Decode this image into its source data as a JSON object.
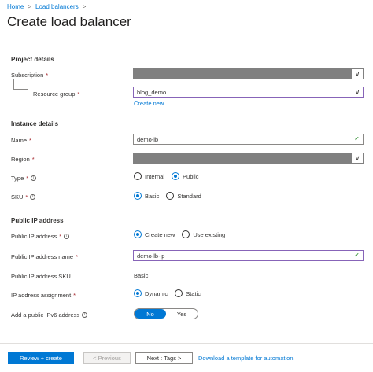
{
  "breadcrumb": {
    "items": [
      "Home",
      "Load balancers"
    ],
    "separator": ">"
  },
  "page": {
    "title": "Create load balancer",
    "cut_text": "~ ~ ~ ~ ~ ~ ~ ~ ~ ~ ~ ~ ~"
  },
  "project": {
    "heading": "Project details",
    "subscription_label": "Subscription",
    "resource_group_label": "Resource group",
    "resource_group_value": "blog_demo",
    "create_new": "Create new"
  },
  "instance": {
    "heading": "Instance details",
    "name_label": "Name",
    "name_value": "demo-lb",
    "region_label": "Region",
    "type_label": "Type",
    "type_options": [
      "Internal",
      "Public"
    ],
    "type_selected": "Public",
    "sku_label": "SKU",
    "sku_options": [
      "Basic",
      "Standard"
    ],
    "sku_selected": "Basic"
  },
  "public_ip": {
    "heading": "Public IP address",
    "ip_label": "Public IP address",
    "ip_options": [
      "Create new",
      "Use existing"
    ],
    "ip_name_label": "Public IP address name",
    "ip_name_value": "demo-lb-ip",
    "sku_label": "Public IP address SKU",
    "sku_value": "Basic",
    "assignment_label": "IP address assignment",
    "assignment_options": [
      "Dynamic",
      "Static"
    ],
    "ipv6_label": "Add a public IPv6 address",
    "ipv6_options": [
      "No",
      "Yes"
    ]
  },
  "common": {
    "required": "*",
    "info": "i",
    "chevron": "∨",
    "check": "✓"
  },
  "footer": {
    "review_create": "Review + create",
    "previous": "< Previous",
    "next": "Next : Tags >",
    "download": "Download a template for automation"
  },
  "colors": {
    "accent": "#0078d4",
    "focus_border": "#8764b8",
    "required": "#a4262c",
    "valid": "#107c10"
  }
}
